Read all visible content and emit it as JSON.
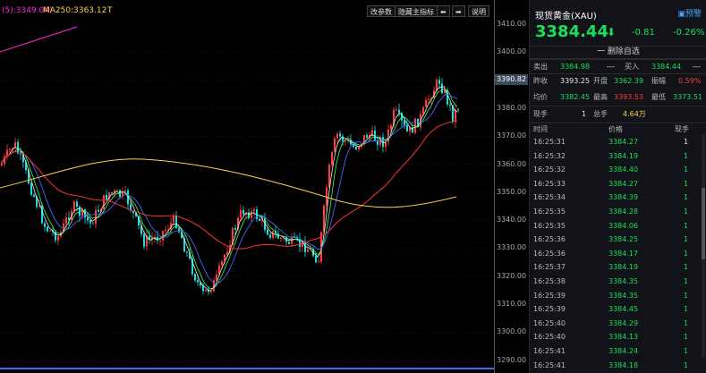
{
  "chart": {
    "ma_label_1": "(5):3349.04)",
    "ma_label_2": "MA250:3363.12",
    "ma_label_3": "T",
    "buttons": [
      "改参数",
      "隐藏主指标",
      "⬅",
      "➡",
      "说明"
    ],
    "colors": {
      "up": "#ff3b3b",
      "down": "#19e0e0",
      "ma_short": "#ff2bd6",
      "ma_long": "#ffd24a",
      "ma_red": "#ff3030",
      "ma_blue": "#4466ff",
      "ma_green": "#30ff60",
      "ma_white": "#e8e8e8"
    }
  },
  "axis": {
    "ticks": [
      "3410.00",
      "3400.00",
      "3390.00",
      "3380.00",
      "3370.00",
      "3360.00",
      "3350.00",
      "3340.00",
      "3330.00",
      "3320.00",
      "3310.00",
      "3300.00",
      "3290.00"
    ],
    "current_price_tag": "3390.82"
  },
  "panel": {
    "title": "现货黄金(XAU)",
    "alert_label": "预警",
    "price": "3384.44",
    "change": "-0.81",
    "change_pct": "-0.26%",
    "remove_label": "一 删除自选",
    "sell_label": "卖出",
    "sell_value": "3384.98",
    "sell_vol": "---",
    "buy_label": "买入",
    "buy_value": "3384.44",
    "buy_vol": "---",
    "prev_close_label": "昨收",
    "prev_close_value": "3393.25",
    "open_label": "开盘",
    "open_value": "3362.39",
    "amplitude_label": "振幅",
    "amplitude_value": "0.59%",
    "avg_label": "均价",
    "avg_value": "3382.45",
    "high_label": "最高",
    "high_value": "3393.53",
    "low_label": "最低",
    "low_value": "3373.51",
    "cur_vol_label": "现手",
    "cur_vol_value": "1",
    "total_vol_label": "总手",
    "total_vol_value": "4.64万",
    "trade_headers": [
      "时间",
      "价格",
      "现手"
    ],
    "trades": [
      {
        "time": "16:25:31",
        "price": "3384.27",
        "vol": "1",
        "vol_color": "white"
      },
      {
        "time": "16:25:32",
        "price": "3384.19",
        "vol": "1",
        "vol_color": "green"
      },
      {
        "time": "16:25:32",
        "price": "3384.40",
        "vol": "1",
        "vol_color": "green"
      },
      {
        "time": "16:25:33",
        "price": "3384.27",
        "vol": "1",
        "vol_color": "green"
      },
      {
        "time": "16:25:34",
        "price": "3384.39",
        "vol": "1",
        "vol_color": "green"
      },
      {
        "time": "16:25:35",
        "price": "3384.28",
        "vol": "1",
        "vol_color": "green"
      },
      {
        "time": "16:25:35",
        "price": "3384.06",
        "vol": "1",
        "vol_color": "green"
      },
      {
        "time": "16:25:36",
        "price": "3384.25",
        "vol": "1",
        "vol_color": "green"
      },
      {
        "time": "16:25:36",
        "price": "3384.17",
        "vol": "1",
        "vol_color": "green"
      },
      {
        "time": "16:25:37",
        "price": "3384.19",
        "vol": "1",
        "vol_color": "green"
      },
      {
        "time": "16:25:38",
        "price": "3384.35",
        "vol": "1",
        "vol_color": "green"
      },
      {
        "time": "16:25:39",
        "price": "3384.35",
        "vol": "1",
        "vol_color": "green"
      },
      {
        "time": "16:25:39",
        "price": "3384.45",
        "vol": "1",
        "vol_color": "green"
      },
      {
        "time": "16:25:40",
        "price": "3384.29",
        "vol": "1",
        "vol_color": "green"
      },
      {
        "time": "16:25:40",
        "price": "3384.13",
        "vol": "1",
        "vol_color": "green"
      },
      {
        "time": "16:25:41",
        "price": "3384.24",
        "vol": "1",
        "vol_color": "green"
      },
      {
        "time": "16:25:41",
        "price": "3384.18",
        "vol": "1",
        "vol_color": "green"
      }
    ]
  }
}
